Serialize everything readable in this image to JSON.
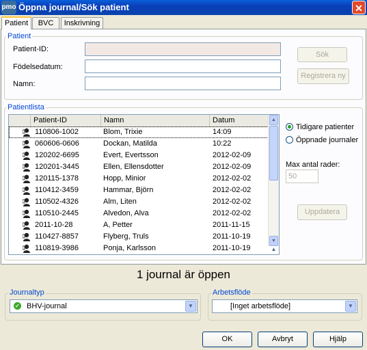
{
  "window": {
    "title": "Öppna journal/Sök patient",
    "icon_text": "pmo",
    "close_label": "✕"
  },
  "tabs": [
    {
      "label": "Patient",
      "active": true
    },
    {
      "label": "BVC",
      "active": false
    },
    {
      "label": "Inskrivning",
      "active": false
    }
  ],
  "patient_group": {
    "legend": "Patient",
    "patient_id_label": "Patient-ID:",
    "birthdate_label": "Födelsedatum:",
    "name_label": "Namn:",
    "patient_id_value": "",
    "birthdate_value": "",
    "name_value": "",
    "search_button": "Sök",
    "register_button": "Registrera ny"
  },
  "patient_list": {
    "legend": "Patientlista",
    "columns": [
      "Patient-ID",
      "Namn",
      "Datum"
    ],
    "rows": [
      {
        "id": "110806-1002",
        "name": "Blom, Trixie",
        "date": "14:09"
      },
      {
        "id": "060606-0606",
        "name": "Dockan, Matilda",
        "date": "10:22"
      },
      {
        "id": "120202-6695",
        "name": "Evert, Evertsson",
        "date": "2012-02-09"
      },
      {
        "id": "120201-3445",
        "name": "Ellen, Ellensdotter",
        "date": "2012-02-09"
      },
      {
        "id": "120115-1378",
        "name": "Hopp, Minior",
        "date": "2012-02-02"
      },
      {
        "id": "110412-3459",
        "name": "Hammar, Björn",
        "date": "2012-02-02"
      },
      {
        "id": "110502-4326",
        "name": "Alm, Liten",
        "date": "2012-02-02"
      },
      {
        "id": "110510-2445",
        "name": "Alvedon, Alva",
        "date": "2012-02-02"
      },
      {
        "id": "2011-10-28",
        "name": "A, Petter",
        "date": "2011-11-15"
      },
      {
        "id": "110427-8857",
        "name": "Flyberg, Truls",
        "date": "2011-10-19"
      },
      {
        "id": "110819-3986",
        "name": "Ponja, Karlsson",
        "date": "2011-10-19"
      }
    ],
    "radio_previous": "Tidigare patienter",
    "radio_opened": "Öppnade journaler",
    "max_rows_label": "Max antal rader:",
    "max_rows_value": "50",
    "update_button": "Uppdatera"
  },
  "status_text": "1 journal är öppen",
  "journal_type": {
    "legend": "Journaltyp",
    "value": "BHV-journal"
  },
  "workflow": {
    "legend": "Arbetsflöde",
    "value": "[Inget arbetsflöde]"
  },
  "buttons": {
    "ok": "OK",
    "cancel": "Avbryt",
    "help": "Hjälp"
  },
  "colors": {
    "titlebar": "#0A50C8",
    "legend": "#0046D5",
    "accent": "#FFC83C"
  }
}
